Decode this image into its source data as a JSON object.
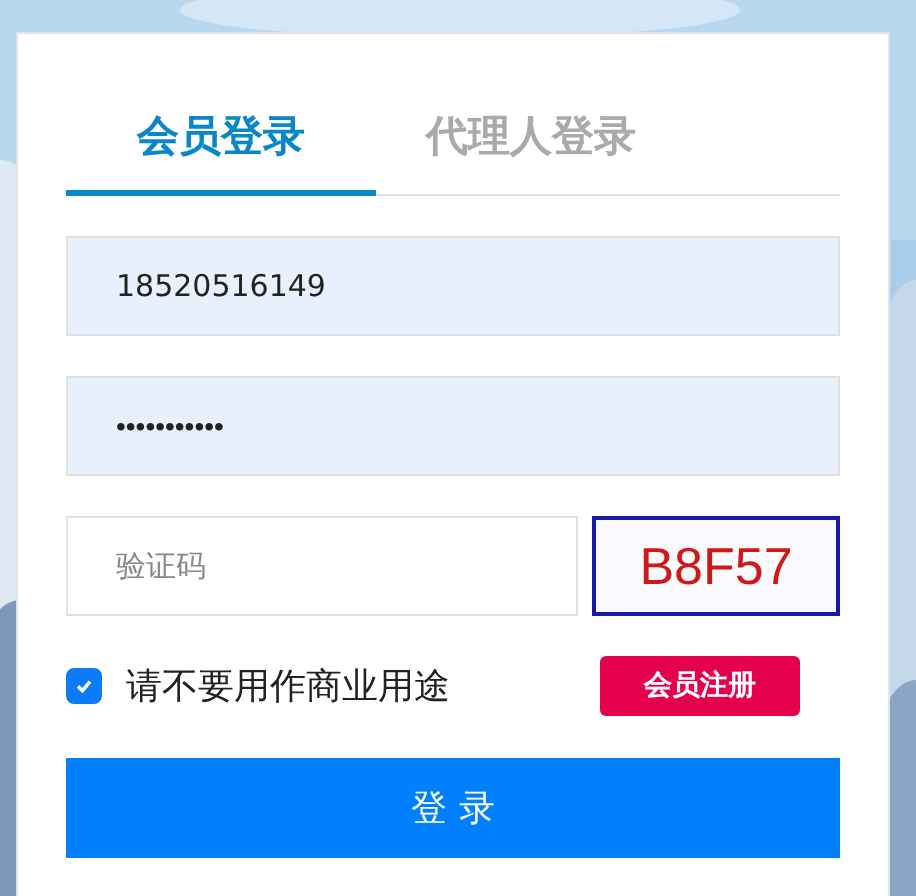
{
  "tabs": [
    {
      "label": "会员登录",
      "selected": true
    },
    {
      "label": "代理人登录",
      "selected": false
    }
  ],
  "phone": {
    "value": "18520516149"
  },
  "password": {
    "value": "•••••••••••"
  },
  "captcha": {
    "placeholder": "验证码",
    "code": "B8F57"
  },
  "agreement": {
    "label": "请不要用作商业用途",
    "checked": true
  },
  "register_button": "会员注册",
  "login_button": "登 录"
}
